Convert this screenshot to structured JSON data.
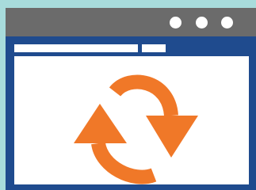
{
  "window": {
    "title": "",
    "controls": [
      "window-dot",
      "window-dot",
      "window-dot"
    ]
  },
  "toolbar": {
    "address_value": "",
    "button_label": ""
  },
  "content": {
    "icon": "refresh-icon"
  },
  "colors": {
    "background": "#a8dcdc",
    "frame": "#1f4b8e",
    "titlebar": "#6b6b6b",
    "content": "#ffffff",
    "accent": "#f07828"
  }
}
